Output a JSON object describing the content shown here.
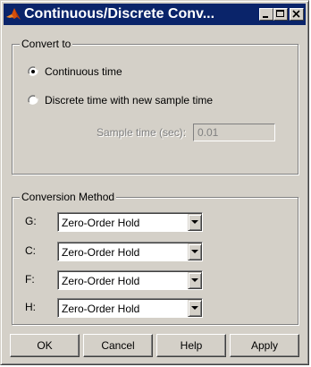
{
  "window": {
    "title": "Continuous/Discrete Conv...",
    "controls": [
      "minimize-icon",
      "maximize-icon",
      "close-icon"
    ],
    "title_bar_color": "#0a246a",
    "face_color": "#d4d0c8"
  },
  "convert_to": {
    "label": "Convert to",
    "options": [
      {
        "label": "Continuous time",
        "selected": true
      },
      {
        "label": "Discrete time with new sample time",
        "selected": false
      }
    ],
    "sample_time_label": "Sample time (sec):",
    "sample_time_value": "0.01",
    "sample_time_enabled": false
  },
  "conversion_method": {
    "label": "Conversion Method",
    "rows": [
      {
        "label": "G:",
        "value": "Zero-Order Hold"
      },
      {
        "label": "C:",
        "value": "Zero-Order Hold"
      },
      {
        "label": "F:",
        "value": "Zero-Order Hold"
      },
      {
        "label": "H:",
        "value": "Zero-Order Hold"
      }
    ]
  },
  "buttons": {
    "ok": "OK",
    "cancel": "Cancel",
    "help": "Help",
    "apply": "Apply"
  }
}
